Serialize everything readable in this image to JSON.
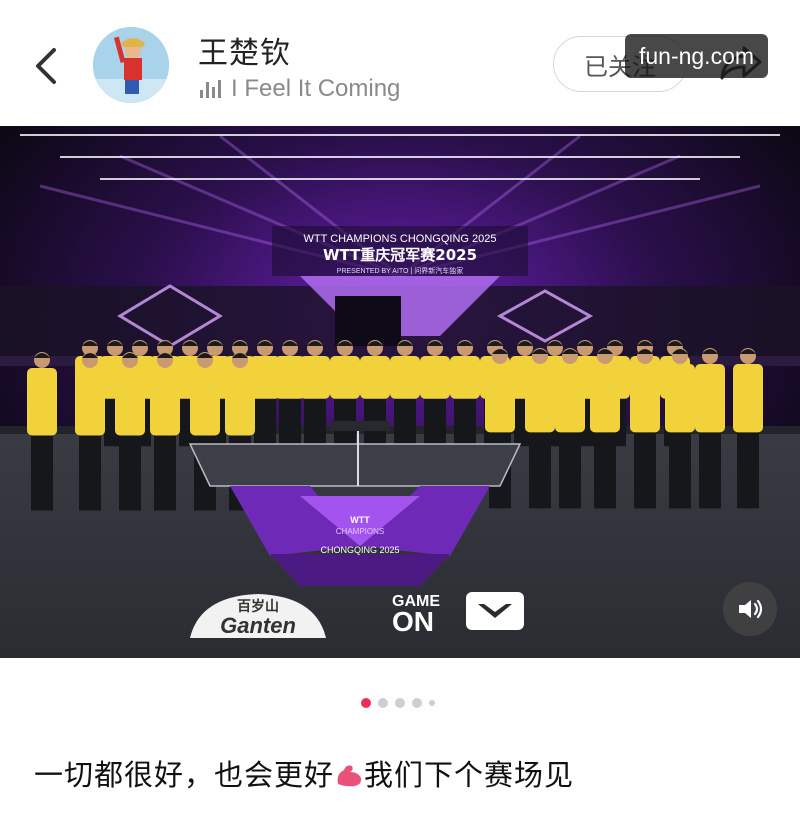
{
  "header": {
    "username": "王楚钦",
    "music_track": "I Feel It Coming",
    "follow_label": "已关注",
    "watermark": "fun-ng.com"
  },
  "photo": {
    "banner_line1": "WTT CHAMPIONS CHONGQING 2025",
    "banner_line2": "WTT重庆冠军赛2025",
    "banner_line3": "PRESENTED BY AITO | 问界新汽车独家",
    "table_logo_line1": "WTT",
    "table_logo_line2": "CHAMPIONS",
    "table_logo_line3": "CHONGQING 2025",
    "floor_sponsor_line1": "百岁山",
    "floor_sponsor_line2": "Ganten",
    "floor_game_on_line1": "GAME",
    "floor_game_on_line2": "ON"
  },
  "carousel": {
    "count": 5,
    "active_index": 0
  },
  "post": {
    "caption_part1": "一切都很好，也会更好",
    "caption_emoji": "flexed-biceps-icon",
    "caption_part2": "我们下个赛场见"
  },
  "colors": {
    "accent": "#ee2f55",
    "stage_purple": "#8e2bd6",
    "jersey_yellow": "#f2d23b"
  }
}
